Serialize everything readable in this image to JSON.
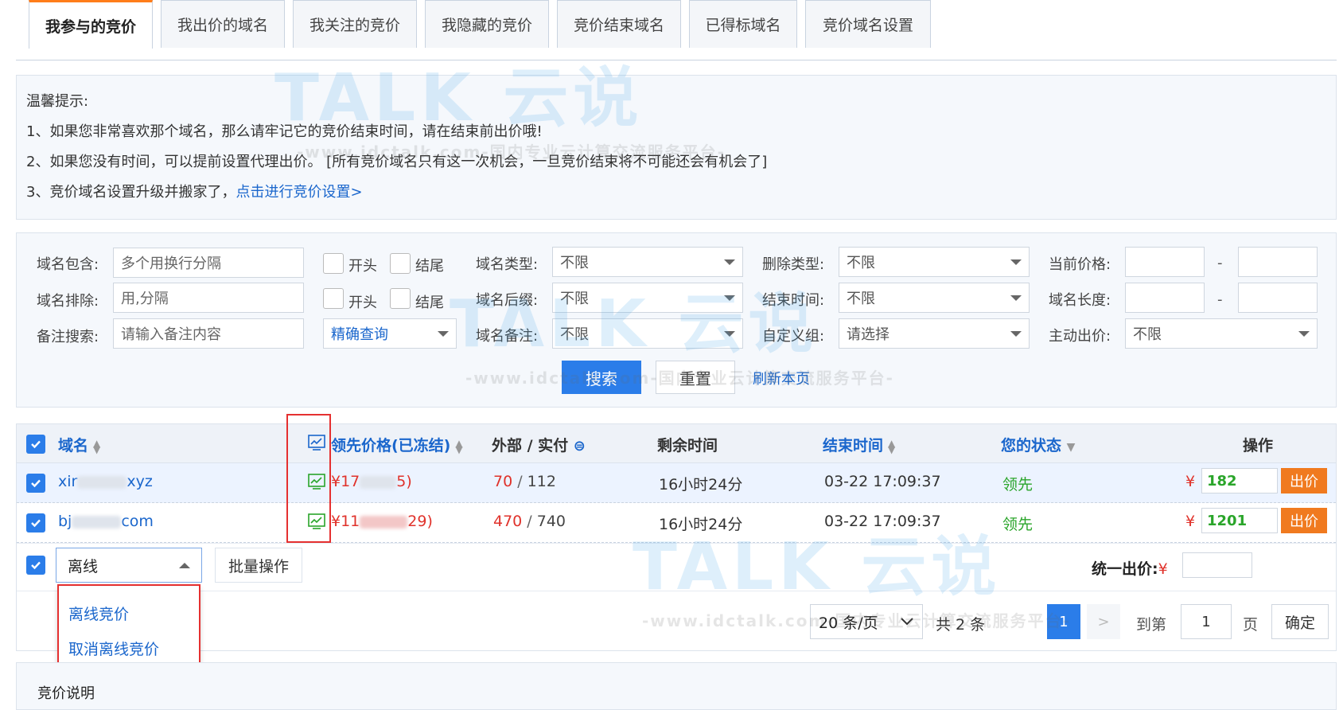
{
  "tabs": [
    {
      "label": "我参与的竞价",
      "active": true
    },
    {
      "label": "我出价的域名"
    },
    {
      "label": "我关注的竞价"
    },
    {
      "label": "我隐藏的竞价"
    },
    {
      "label": "竞价结束域名"
    },
    {
      "label": "已得标域名"
    },
    {
      "label": "竞价域名设置"
    }
  ],
  "tips": {
    "title": "温馨提示:",
    "line1": "1、如果您非常喜欢那个域名，那么请牢记它的竞价结束时间，请在结束前出价哦!",
    "line2": "2、如果您没有时间，可以提前设置代理出价。 [所有竞价域名只有这一次机会，一旦竞价结束将不可能还会有机会了]",
    "line3": "3、竞价域名设置升级并搬家了，",
    "line3_link": "点击进行竞价设置>"
  },
  "filter": {
    "include_label": "域名包含:",
    "include_placeholder": "多个用换行分隔",
    "exclude_label": "域名排除:",
    "exclude_placeholder": "用,分隔",
    "note_search_label": "备注搜索:",
    "note_search_placeholder": "请输入备注内容",
    "start_label": "开头",
    "end_label": "结尾",
    "match_mode": "精确查询",
    "domain_type_label": "域名类型:",
    "domain_type_value": "不限",
    "suffix_label": "域名后缀:",
    "suffix_value": "不限",
    "note_label": "域名备注:",
    "note_value": "不限",
    "delete_type_label": "删除类型:",
    "delete_type_value": "不限",
    "end_time_label": "结束时间:",
    "end_time_value": "不限",
    "group_label": "自定义组:",
    "group_value": "请选择",
    "price_label": "当前价格:",
    "length_label": "域名长度:",
    "active_bid_label": "主动出价:",
    "active_bid_value": "不限",
    "range_sep": "-",
    "search_btn": "搜索",
    "reset_btn": "重置",
    "refresh_link": "刷新本页"
  },
  "table": {
    "headers": {
      "domain": "域名",
      "lead_price": "领先价格(已冻结)",
      "outer_paid": "外部 / 实付",
      "remaining": "剩余时间",
      "end_time": "结束时间",
      "status": "您的状态",
      "action": "操作"
    },
    "rows": [
      {
        "domain_prefix": "xir",
        "domain_suffix": "xyz",
        "price_prefix": "¥17",
        "price_suffix": "5)",
        "outer": "70",
        "sep": " / ",
        "paid": "112",
        "remaining": "16小时24分",
        "end_time": "03-22 17:09:37",
        "status": "领先",
        "currency": "¥",
        "bid": "182",
        "bid_btn": "出价"
      },
      {
        "domain_prefix": "bj",
        "domain_suffix": "com",
        "price_prefix": "¥11",
        "price_suffix": "29)",
        "outer": "470",
        "sep": " / ",
        "paid": "740",
        "remaining": "16小时24分",
        "end_time": "03-22 17:09:37",
        "status": "领先",
        "currency": "¥",
        "bid": "1201",
        "bid_btn": "出价"
      }
    ]
  },
  "batch": {
    "dropdown_value": "离线",
    "batch_btn": "批量操作",
    "menu_items": [
      "离线竞价",
      "取消离线竞价"
    ],
    "unified_bid_label": "统一出价:",
    "currency": "¥"
  },
  "pagination": {
    "page_size": "20 条/页",
    "total": "共 2 条",
    "current": "1",
    "next": ">",
    "goto_label": "到第",
    "goto_value": "1",
    "page_unit": "页",
    "confirm": "确定"
  },
  "footer": {
    "title": "竞价说明"
  },
  "watermark": {
    "text": "TALK 云说",
    "sub": "-www.idctalk.com-国内专业云计算交流服务平台-"
  },
  "colors": {
    "accent": "#2b7de9",
    "orange": "#f07a1f",
    "red": "#e0322b",
    "green": "#2aa52a"
  }
}
